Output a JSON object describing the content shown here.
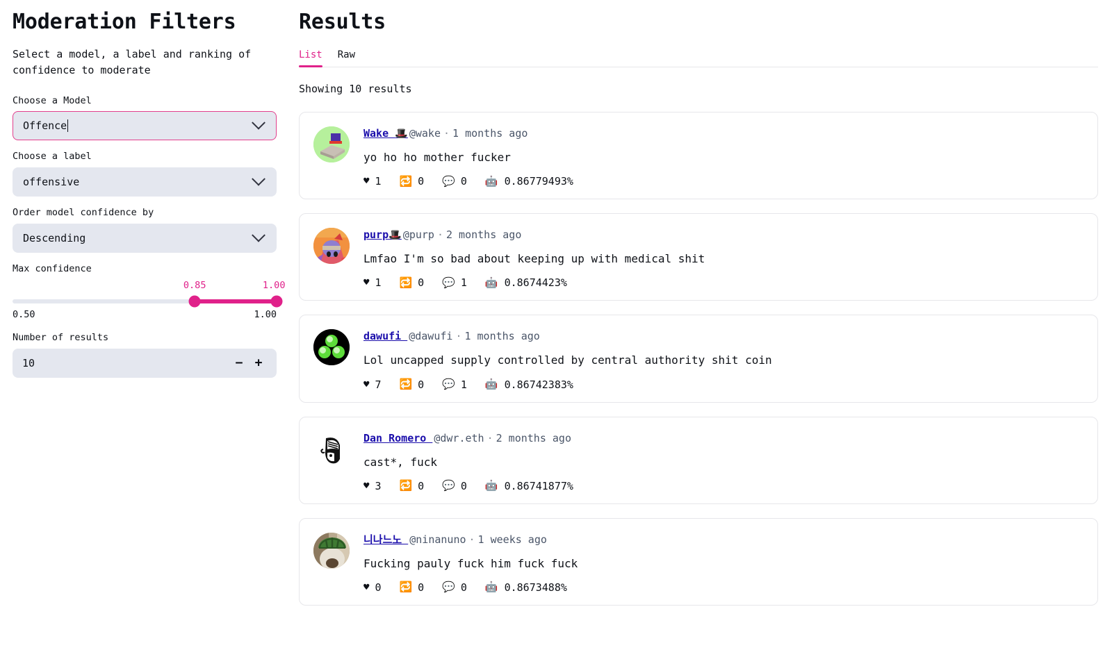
{
  "sidebar": {
    "title": "Moderation Filters",
    "description": "Select a model, a label and ranking of confidence to moderate",
    "model_field": {
      "label": "Choose a Model",
      "value": "Offence"
    },
    "label_field": {
      "label": "Choose a label",
      "value": "offensive"
    },
    "order_field": {
      "label": "Order model confidence by",
      "value": "Descending"
    },
    "confidence_slider": {
      "label": "Max confidence",
      "low_value": "0.85",
      "high_value": "1.00",
      "min_bound": "0.50",
      "max_bound": "1.00",
      "accent_color": "#e0218a"
    },
    "results_count": {
      "label": "Number of results",
      "value": "10",
      "decrement_label": "−",
      "increment_label": "+"
    }
  },
  "results": {
    "title": "Results",
    "tabs": [
      {
        "label": "List",
        "active": true
      },
      {
        "label": "Raw",
        "active": false
      }
    ],
    "showing": "Showing 10 results",
    "icons": {
      "like": "♥",
      "recast": "🔁",
      "comment": "💬",
      "confidence": "🤖"
    },
    "cards": [
      {
        "display_name": "Wake ",
        "name_emoji": "🎩",
        "handle": "@wake",
        "time": "1 months ago",
        "text": "yo ho ho mother fucker",
        "likes": "1",
        "recasts": "0",
        "comments": "0",
        "confidence": "0.86779493%",
        "avatar": "av-wake"
      },
      {
        "display_name": "purp",
        "name_emoji": "🎩",
        "handle": "@purp",
        "time": "2 months ago",
        "text": "Lmfao I'm so bad about keeping up with medical shit",
        "likes": "1",
        "recasts": "0",
        "comments": "1",
        "confidence": "0.8674423%",
        "avatar": "av-purp"
      },
      {
        "display_name": "dawufi ",
        "name_emoji": "",
        "handle": "@dawufi",
        "time": "1 months ago",
        "text": "Lol uncapped supply controlled by central authority shit coin",
        "likes": "7",
        "recasts": "0",
        "comments": "1",
        "confidence": "0.86742383%",
        "avatar": "av-dawufi"
      },
      {
        "display_name": "Dan Romero ",
        "name_emoji": "",
        "handle": "@dwr.eth",
        "time": "2 months ago",
        "text": "cast*, fuck",
        "likes": "3",
        "recasts": "0",
        "comments": "0",
        "confidence": "0.86741877%",
        "avatar": "av-dan"
      },
      {
        "display_name": "니나느노 ",
        "name_emoji": "",
        "handle": "@ninanuno",
        "time": "1 weeks ago",
        "text": "Fucking pauly fuck him fuck fuck",
        "likes": "0",
        "recasts": "0",
        "comments": "0",
        "confidence": "0.8673488%",
        "avatar": "av-nina"
      }
    ]
  }
}
